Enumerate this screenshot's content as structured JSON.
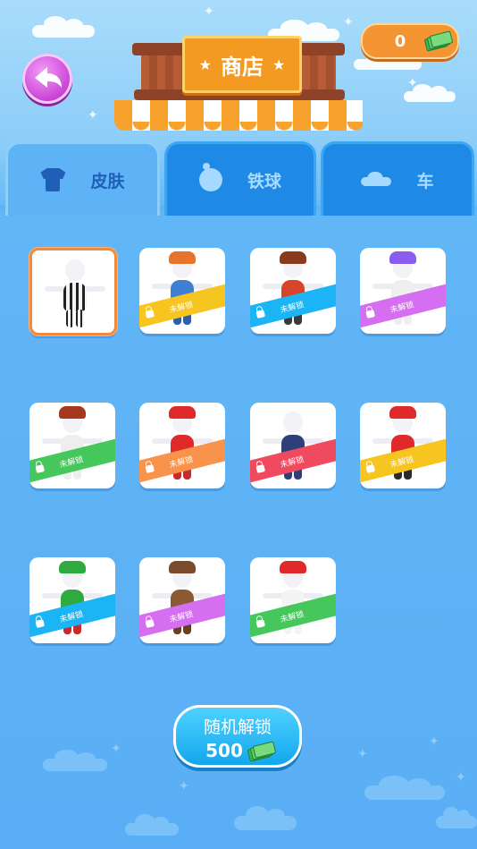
{
  "header": {
    "shop_title": "商店",
    "coins": "0"
  },
  "tabs": [
    {
      "label": "皮肤",
      "icon": "shirt-icon",
      "active": true
    },
    {
      "label": "铁球",
      "icon": "ball-icon",
      "active": false
    },
    {
      "label": "车",
      "icon": "car-icon",
      "active": false
    }
  ],
  "skins": [
    {
      "name": "prisoner",
      "locked": false,
      "selected": true
    },
    {
      "name": "orange-hair",
      "locked": true,
      "lock_label": "未解锁",
      "ribbon_color": "#f6c51f"
    },
    {
      "name": "top-hat",
      "locked": true,
      "lock_label": "未解锁",
      "ribbon_color": "#1bb5f5"
    },
    {
      "name": "feather-headband",
      "locked": true,
      "lock_label": "未解锁",
      "ribbon_color": "#d56ef0"
    },
    {
      "name": "hair-bun",
      "locked": true,
      "lock_label": "未解锁",
      "ribbon_color": "#46c75c"
    },
    {
      "name": "red-cap",
      "locked": true,
      "lock_label": "未解锁",
      "ribbon_color": "#f7934a"
    },
    {
      "name": "sunglasses-suit",
      "locked": true,
      "lock_label": "未解锁",
      "ribbon_color": "#f04a5e"
    },
    {
      "name": "santa",
      "locked": true,
      "lock_label": "未解锁",
      "ribbon_color": "#f6c51f"
    },
    {
      "name": "elf",
      "locked": true,
      "lock_label": "未解锁",
      "ribbon_color": "#1bb5f5"
    },
    {
      "name": "reindeer",
      "locked": true,
      "lock_label": "未解锁",
      "ribbon_color": "#d56ef0"
    },
    {
      "name": "snowman",
      "locked": true,
      "lock_label": "未解锁",
      "ribbon_color": "#46c75c"
    }
  ],
  "random_unlock": {
    "label": "随机解锁",
    "price": "500"
  },
  "colors": {
    "background": "#5fb4f6",
    "tab_active": "#5db3f6",
    "tab_inactive": "#1e8ae6",
    "coin_box": "#f59433",
    "back_button": "#c945d6",
    "button": "#12a7ee"
  }
}
